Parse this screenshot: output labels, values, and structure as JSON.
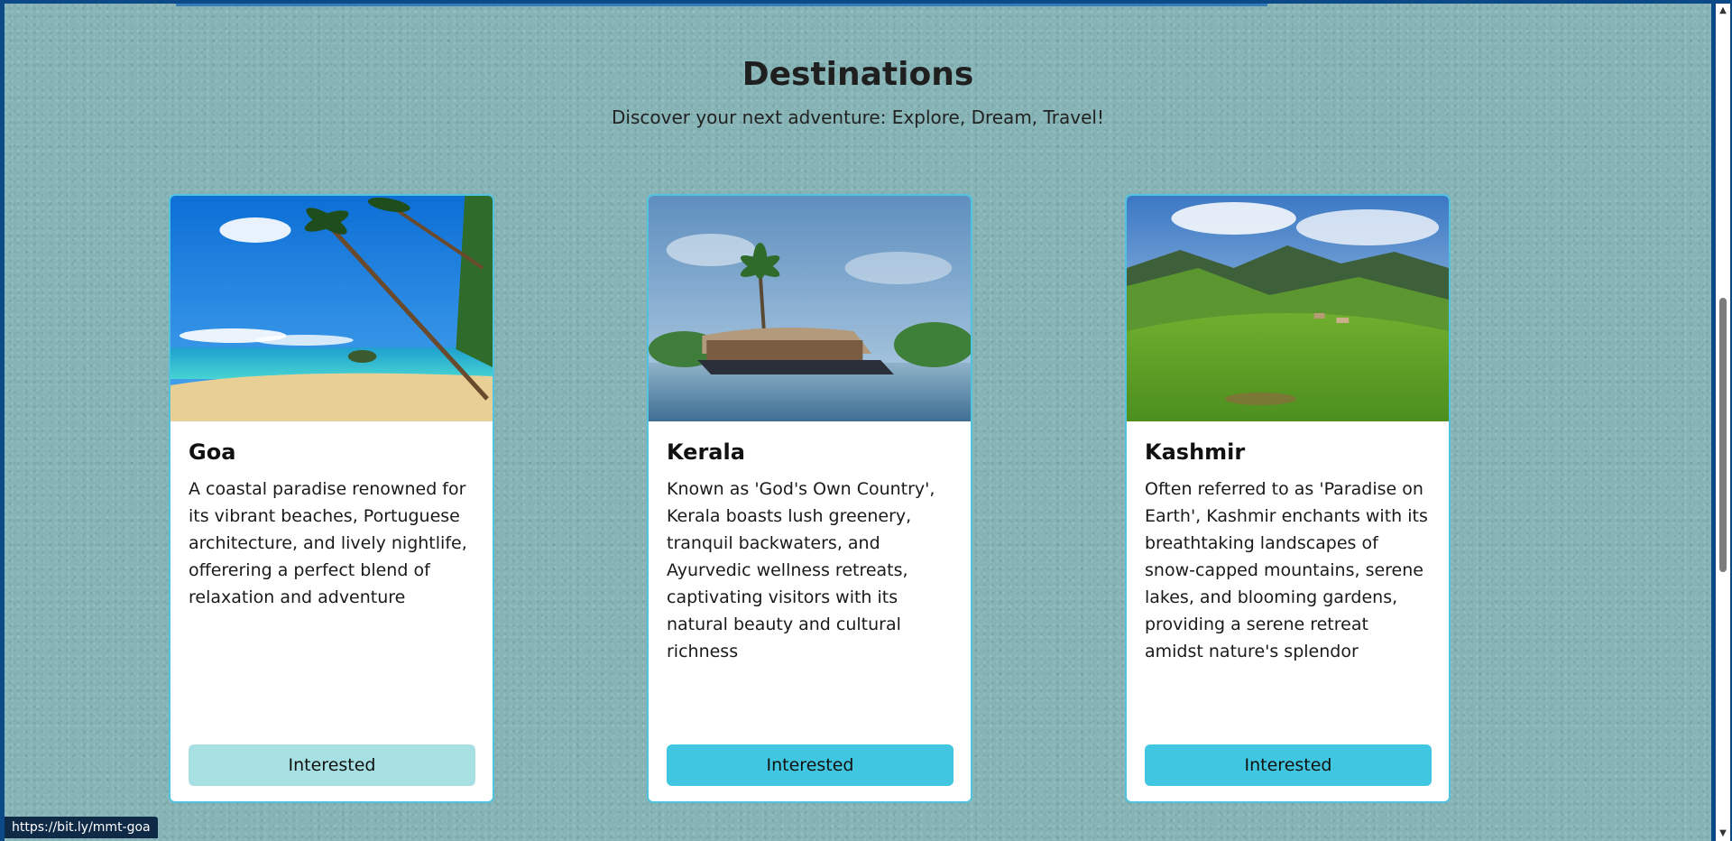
{
  "header": {
    "title": "Destinations",
    "subtitle": "Discover your next adventure: Explore, Dream, Travel!"
  },
  "cards": [
    {
      "title": "Goa",
      "description": "A coastal paradise renowned for its vibrant beaches, Portuguese architecture, and lively nightlife, offerering a perfect blend of relaxation and adventure",
      "button_label": "Interested"
    },
    {
      "title": "Kerala",
      "description": "Known as 'God's Own Country', Kerala boasts lush greenery, tranquil backwaters, and Ayurvedic wellness retreats, captivating visitors with its natural beauty and cultural richness",
      "button_label": "Interested"
    },
    {
      "title": "Kashmir",
      "description": "Often referred to as 'Paradise on Earth', Kashmir enchants with its breathtaking landscapes of snow-capped mountains, serene lakes, and blooming gardens, providing a serene retreat amidst nature's splendor",
      "button_label": "Interested"
    }
  ],
  "status_bar": {
    "url": "https://bit.ly/mmt-goa"
  },
  "colors": {
    "button": "#40c6e0",
    "button_hover": "#a7e0e2",
    "card_border": "#50c3df",
    "page_background": "#86b4b6"
  },
  "icons": {
    "scroll_up": "scroll-up-arrow-icon",
    "scroll_down": "scroll-down-arrow-icon"
  }
}
